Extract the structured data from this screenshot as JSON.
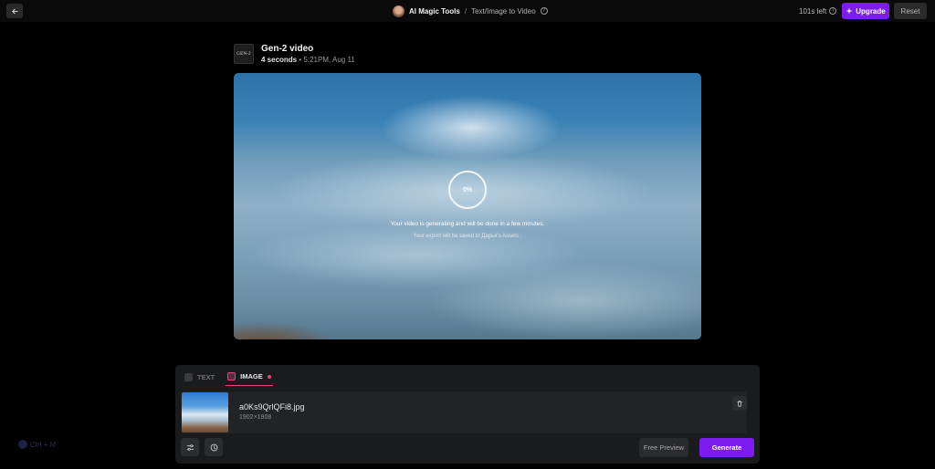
{
  "topbar": {
    "app_name": "AI Magic Tools",
    "separator": "/",
    "page_name": "Text/Image to Video",
    "credits": "101s left",
    "upgrade_label": "Upgrade",
    "reset_label": "Reset"
  },
  "video": {
    "logo_text": "GEN-2",
    "title": "Gen-2 video",
    "duration": "4 seconds",
    "meta_sep": "•",
    "timestamp": "5:21PM, Aug 11",
    "progress": "0%",
    "generating_message": "Your video is generating and will be done in a few minutes.",
    "save_message": "Your export will be saved to Дарья's Assets ."
  },
  "prompt_panel": {
    "tabs": [
      {
        "label": "TEXT",
        "active": false
      },
      {
        "label": "IMAGE",
        "active": true
      }
    ],
    "file": {
      "name": "a0Ks9QrlQFi8.jpg",
      "dimensions": "1902×1908"
    },
    "free_preview_label": "Free Preview",
    "generate_label": "Generate"
  },
  "shortcut_hint": "Ctrl + M",
  "colors": {
    "accent": "#7c1cf0",
    "tab_indicator": "#e0457b",
    "background": "#000000",
    "panel": "#1a1b1d"
  },
  "icons": [
    "back-arrow-icon",
    "help-icon",
    "info-icon",
    "sparkle-icon",
    "text-tab-icon",
    "image-tab-icon",
    "trash-icon",
    "settings-sliders-icon",
    "clock-icon"
  ]
}
